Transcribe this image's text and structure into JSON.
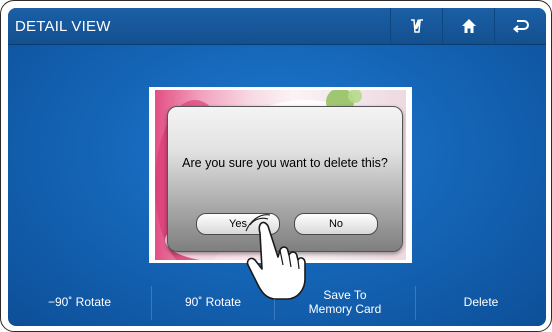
{
  "header": {
    "title": "DETAIL VIEW",
    "icons": [
      "pen-icon",
      "home-icon",
      "back-icon"
    ]
  },
  "dialog": {
    "message": "Are you sure you want to delete this?",
    "yes_label": "Yes",
    "no_label": "No"
  },
  "toolbar": {
    "rotate_left_label": "−90˚ Rotate",
    "rotate_right_label": "90˚ Rotate",
    "save_line1": "Save To",
    "save_line2": "Memory Card",
    "delete_label": "Delete"
  },
  "colors": {
    "screen_blue": "#1566b8",
    "titlebar_blue": "#1b5fa6",
    "photo_pink": "#e24f84"
  }
}
